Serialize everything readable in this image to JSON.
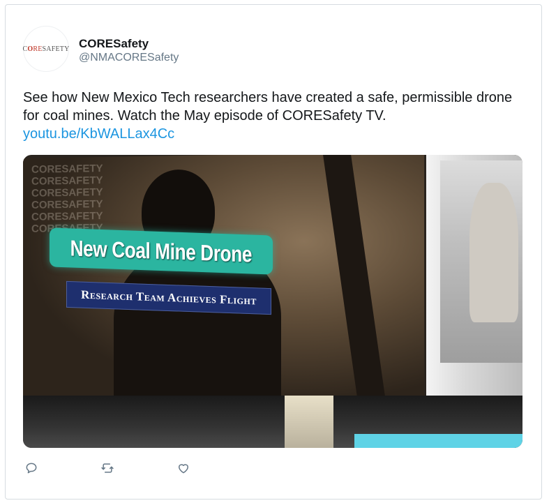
{
  "account": {
    "display_name": "CORESafety",
    "handle": "@NMACORESafety",
    "avatar_logo_parts": [
      "C",
      "O",
      "RE",
      "SAFETY"
    ]
  },
  "tweet": {
    "text": "See how New Mexico Tech researchers have created a safe, permissible drone for coal mines. Watch the May episode of CORESafety TV.",
    "link_text": "youtu.be/KbWALLax4Cc"
  },
  "media": {
    "watermark_lines": [
      "CORESAFETY",
      "CORESAFETY",
      "CORESAFETY",
      "CORESAFETY",
      "CORESAFETY",
      "CORESAFETY"
    ],
    "title": "New Coal Mine Drone",
    "subtitle": "Research Team Achieves Flight"
  },
  "actions": {
    "reply_icon": "reply-icon",
    "retweet_icon": "retweet-icon",
    "like_icon": "heart-icon"
  },
  "colors": {
    "link": "#1b95e0",
    "handle": "#657786",
    "banner_teal": "#2bb5a0",
    "banner_navy": "#1e2f6e",
    "icon_gray": "#657786"
  }
}
